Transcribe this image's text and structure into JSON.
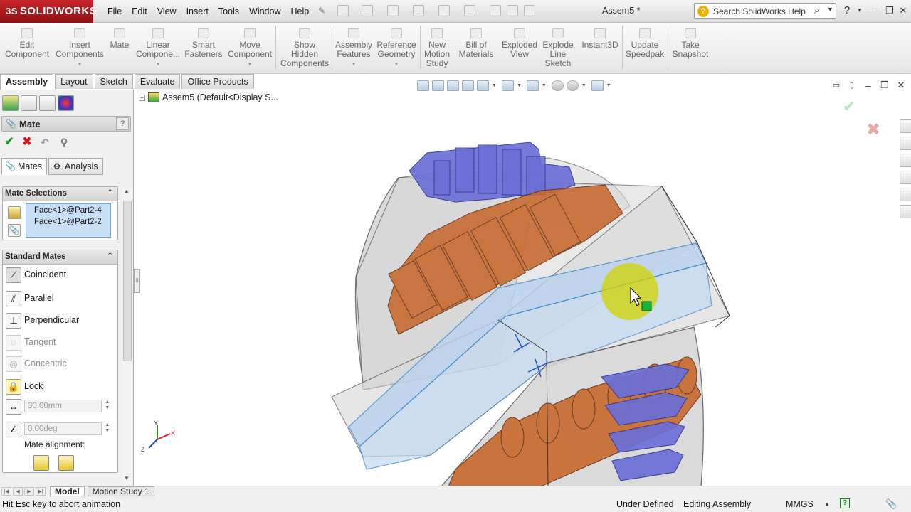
{
  "app": {
    "logo_prefix": "3S",
    "logo_text": "SOLIDWORKS",
    "doc_title": "Assem5 *"
  },
  "menu": [
    "File",
    "Edit",
    "View",
    "Insert",
    "Tools",
    "Window",
    "Help"
  ],
  "search": {
    "placeholder": "Search SolidWorks Help"
  },
  "commands": [
    {
      "label": "Edit\nComponent"
    },
    {
      "label": "Insert\nComponents"
    },
    {
      "label": "Mate"
    },
    {
      "label": "Linear\nCompone..."
    },
    {
      "label": "Smart\nFasteners"
    },
    {
      "label": "Move\nComponent"
    },
    {
      "label": "Show\nHidden\nComponents"
    },
    {
      "label": "Assembly\nFeatures"
    },
    {
      "label": "Reference\nGeometry"
    },
    {
      "label": "New\nMotion\nStudy"
    },
    {
      "label": "Bill of\nMaterials"
    },
    {
      "label": "Exploded\nView"
    },
    {
      "label": "Explode\nLine\nSketch"
    },
    {
      "label": "Instant3D"
    },
    {
      "label": "Update\nSpeedpak"
    },
    {
      "label": "Take\nSnapshot"
    }
  ],
  "cm_tabs": [
    "Assembly",
    "Layout",
    "Sketch",
    "Evaluate",
    "Office Products"
  ],
  "tree": {
    "root": "Assem5  (Default<Display S..."
  },
  "property_manager": {
    "title": "Mate",
    "help": "?",
    "subtabs": [
      "Mates",
      "Analysis"
    ],
    "mate_selections": {
      "header": "Mate Selections",
      "items": [
        "Face<1>@Part2-4",
        "Face<1>@Part2-2"
      ]
    },
    "standard_mates": {
      "header": "Standard Mates",
      "items": [
        {
          "label": "Coincident",
          "enabled": true
        },
        {
          "label": "Parallel",
          "enabled": true
        },
        {
          "label": "Perpendicular",
          "enabled": true
        },
        {
          "label": "Tangent",
          "enabled": false
        },
        {
          "label": "Concentric",
          "enabled": false
        },
        {
          "label": "Lock",
          "enabled": true
        }
      ],
      "distance": "30.00mm",
      "angle": "0.00deg",
      "alignment_label": "Mate alignment:"
    }
  },
  "triad": {
    "x": "X",
    "y": "Y",
    "z": "Z"
  },
  "bottom_tabs": [
    "Model",
    "Motion Study 1"
  ],
  "status": {
    "message": "Hit Esc key to abort animation",
    "defined": "Under Defined",
    "mode": "Editing Assembly",
    "units": "MMGS"
  },
  "colors": {
    "accent_red": "#c8262b",
    "selection_blue": "#c9dff6",
    "part_orange": "#c8682e",
    "part_purple": "#6b6fd6"
  }
}
